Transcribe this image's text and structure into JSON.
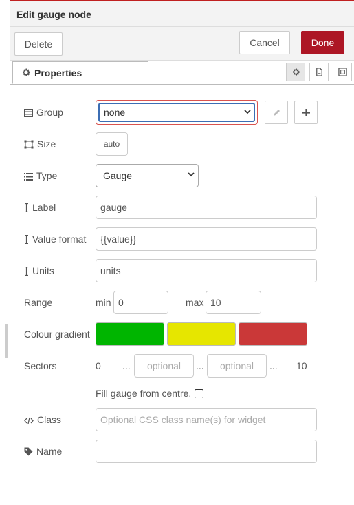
{
  "dialog": {
    "title": "Edit gauge node",
    "delete_label": "Delete",
    "cancel_label": "Cancel",
    "done_label": "Done"
  },
  "tabs": {
    "properties_label": "Properties"
  },
  "form": {
    "group": {
      "label": "Group",
      "value": "none"
    },
    "size": {
      "label": "Size",
      "value": "auto"
    },
    "type": {
      "label": "Type",
      "value": "Gauge"
    },
    "label": {
      "label": "Label",
      "value": "gauge"
    },
    "value_format": {
      "label": "Value format",
      "value": "{{value}}"
    },
    "units": {
      "label": "Units",
      "value": "units"
    },
    "range": {
      "label": "Range",
      "min_label": "min",
      "min_value": "0",
      "max_label": "max",
      "max_value": "10"
    },
    "colour_gradient": {
      "label": "Colour gradient",
      "colors": [
        "#00b500",
        "#e6e600",
        "#ca3838"
      ]
    },
    "sectors": {
      "label": "Sectors",
      "start": "0",
      "sep": "...",
      "placeholder1": "optional",
      "placeholder2": "optional",
      "end": "10"
    },
    "fill_centre": {
      "label": "Fill gauge from centre.",
      "checked": false
    },
    "class": {
      "label": "Class",
      "placeholder": "Optional CSS class name(s) for widget"
    },
    "name": {
      "label": "Name",
      "value": ""
    }
  },
  "colors": {
    "done_bg": "#ad1625",
    "accent_red": "#c02020"
  }
}
